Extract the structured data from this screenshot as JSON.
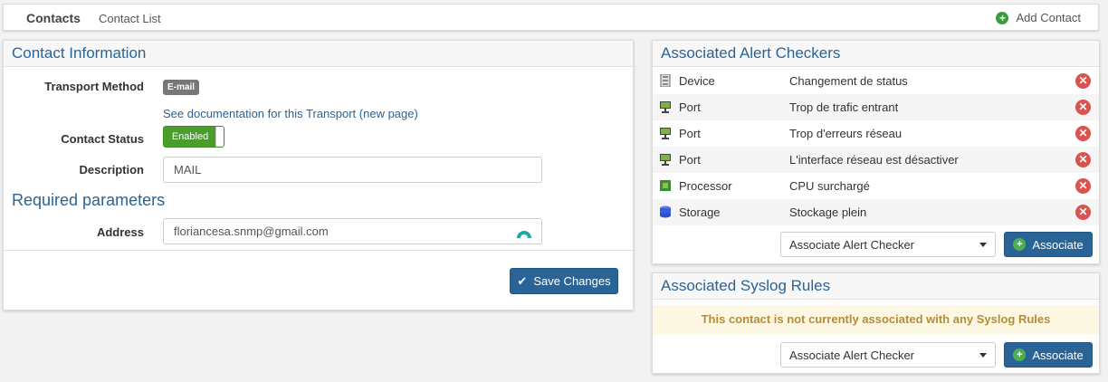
{
  "nav": {
    "brand": "Contacts",
    "contact_list": "Contact List",
    "add_contact": "Add Contact"
  },
  "contact": {
    "title": "Contact Information",
    "transport_label": "Transport Method",
    "transport_badge": "E-mail",
    "doc_link": "See documentation for this Transport (new page)",
    "status_label": "Contact Status",
    "status_value": "Enabled",
    "description_label": "Description",
    "description_value": "MAIL",
    "required_title": "Required parameters",
    "address_label": "Address",
    "address_value": "floriancesa.snmp@gmail.com",
    "save_label": "Save Changes"
  },
  "alerts": {
    "title": "Associated Alert Checkers",
    "rows": [
      {
        "type": "Device",
        "desc": "Changement de status",
        "icon": "device-icon"
      },
      {
        "type": "Port",
        "desc": "Trop de trafic entrant",
        "icon": "port-icon"
      },
      {
        "type": "Port",
        "desc": "Trop d'erreurs réseau",
        "icon": "port-icon"
      },
      {
        "type": "Port",
        "desc": "L'interface réseau est désactiver",
        "icon": "port-icon"
      },
      {
        "type": "Processor",
        "desc": "CPU surchargé",
        "icon": "processor-icon"
      },
      {
        "type": "Storage",
        "desc": "Stockage plein",
        "icon": "storage-icon"
      }
    ],
    "select_value": "Associate Alert Checker",
    "button_label": "Associate"
  },
  "syslog": {
    "title": "Associated Syslog Rules",
    "notice": "This contact is not currently associated with any Syslog Rules",
    "select_value": "Associate Alert Checker",
    "button_label": "Associate"
  },
  "colors": {
    "accent": "#2a6496",
    "enabled": "#4a9c2d",
    "danger": "#d9534f",
    "warning_bg": "#fcf8e3"
  }
}
